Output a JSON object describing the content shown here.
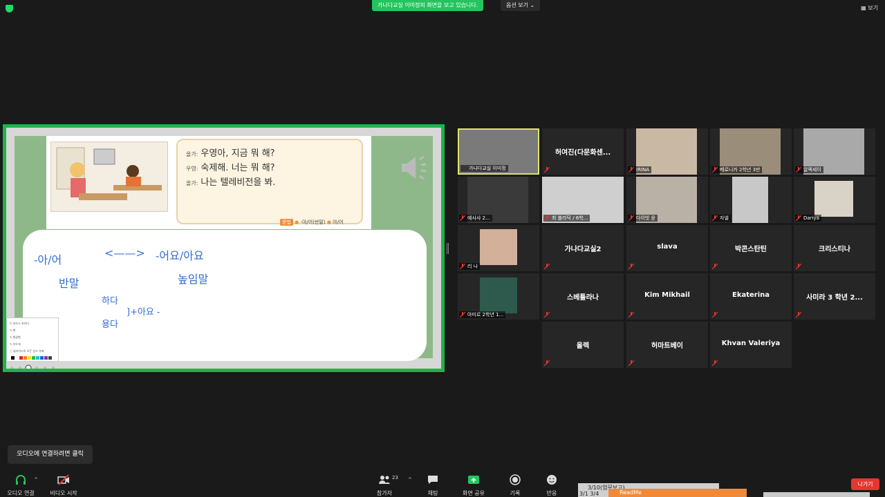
{
  "top": {
    "sharing_banner": "가나다교실 이미정의 화면을 보고 있습니다.",
    "view_options": "옵션 보기",
    "view_toggle": "보기"
  },
  "share": {
    "dialog": [
      {
        "speaker": "올가:",
        "text": "우영아, 지금 뭐 해?"
      },
      {
        "speaker": "우영:",
        "text": "숙제해. 너는 뭐 해?"
      },
      {
        "speaker": "올가:",
        "text": "나는 텔레비전을 봐."
      }
    ],
    "grammar_tags": [
      "문법",
      "-아/어(반말)",
      "아/어"
    ],
    "handwriting": [
      "-아/어",
      "<——>",
      "-어요/아요",
      "반말",
      "높임말",
      "하다",
      "]+아요 -",
      "용다"
    ],
    "annotation_menu": [
      "마우스 포인터",
      "펜",
      "형광펜",
      "지우개",
      "슬라이드의 모든 잉크 삭제"
    ],
    "ink_colors": [
      "#000000",
      "#ffffff",
      "#e02020",
      "#f08020",
      "#f0e020",
      "#20c040",
      "#20c0e0",
      "#2060e0",
      "#8030c0",
      "#404040"
    ]
  },
  "participants": [
    {
      "name": "가나다교실 이미정",
      "video": true,
      "active": true
    },
    {
      "name": "허여진(다문화센...",
      "video": false
    },
    {
      "name": "IRINA",
      "video": true
    },
    {
      "name": "베로니카 2학년 3반",
      "video": true
    },
    {
      "name": "알렉세이",
      "video": true
    },
    {
      "name": "예사샤 2...",
      "video": true
    },
    {
      "name": "최 블라딕 / 6학...",
      "video": true
    },
    {
      "name": "다이빗 윤",
      "video": true
    },
    {
      "name": "자넬",
      "video": true
    },
    {
      "name": "Dariya",
      "video": true
    },
    {
      "name": "리 나",
      "video": true
    },
    {
      "name": "가나다교실2",
      "video": false
    },
    {
      "name": "slava",
      "video": false
    },
    {
      "name": "박콘스탄틴",
      "video": false
    },
    {
      "name": "크리스티나",
      "video": false
    },
    {
      "name": "아미르 2학년 1...",
      "video": true
    },
    {
      "name": "스베틀라나",
      "video": false
    },
    {
      "name": "Kim Mikhail",
      "video": false
    },
    {
      "name": "Ekaterina",
      "video": false
    },
    {
      "name": "사미라 3 학년 2...",
      "video": false
    },
    {
      "name": "올렉",
      "video": false
    },
    {
      "name": "허마트베이",
      "video": false
    },
    {
      "name": "Khvan Valeriya",
      "video": false
    }
  ],
  "audio_tooltip": "오디오에 연결하려면 클릭",
  "controls": {
    "audio": "오디오 연결",
    "video": "비디오 시작",
    "participants": "참가자",
    "participant_count": "23",
    "chat": "채팅",
    "share": "화면 공유",
    "record": "기록",
    "reactions": "반응",
    "leave": "나가기"
  },
  "taskbar": {
    "window1": "3/10(업무보고)",
    "window1_sub": "3/1 3/4",
    "window2": "ReadMe"
  },
  "colors": {
    "share_border": "#22b24c",
    "banner": "#22c55e",
    "leave": "#e5362f",
    "active_speaker": "#dfe36a",
    "mic_muted": "#e5362f"
  }
}
